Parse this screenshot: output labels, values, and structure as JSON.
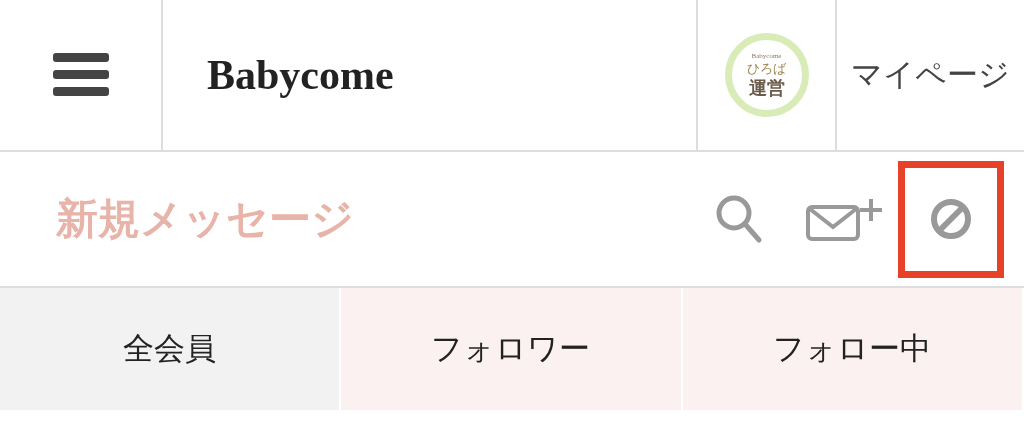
{
  "header": {
    "logo": "Babycome",
    "avatar": {
      "brand": "Babycome",
      "name": "ひろば",
      "role": "運営"
    },
    "mypage_link": "マイページ"
  },
  "toolbar": {
    "title": "新規メッセージ",
    "tools": [
      {
        "kind": "search",
        "highlighted": false
      },
      {
        "kind": "new-mail",
        "highlighted": false
      },
      {
        "kind": "block",
        "highlighted": true
      }
    ]
  },
  "tabs": [
    {
      "label": "全会員",
      "color": "#f2f2f2"
    },
    {
      "label": "フォロワー",
      "color": "#fbf1f0"
    },
    {
      "label": "フォロー中",
      "color": "#fbf1f0"
    }
  ]
}
